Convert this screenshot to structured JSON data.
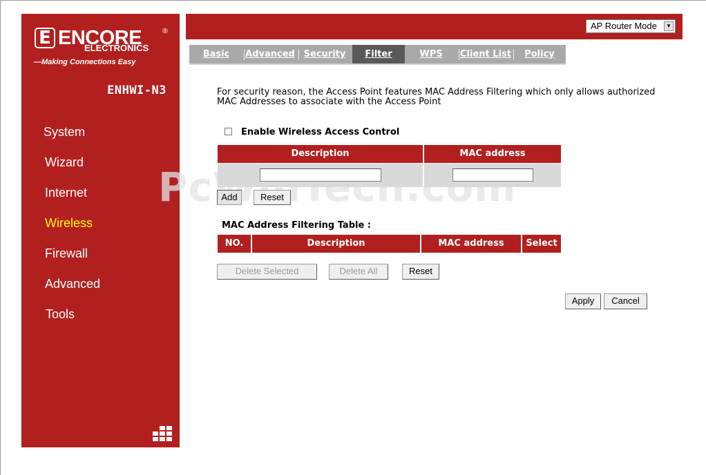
{
  "brand": {
    "name": "ENCORE",
    "registered": "®",
    "sub": "ELECTRONICS",
    "tagline": "—Making Connections Easy",
    "model": "ENHWI-N3"
  },
  "nav": [
    {
      "label": "System",
      "active": false
    },
    {
      "label": "Wizard",
      "active": false
    },
    {
      "label": "Internet",
      "active": false
    },
    {
      "label": "Wireless",
      "active": true
    },
    {
      "label": "Firewall",
      "active": false
    },
    {
      "label": "Advanced",
      "active": false
    },
    {
      "label": "Tools",
      "active": false
    }
  ],
  "mode_select": {
    "value": "AP Router Mode"
  },
  "tabs": [
    {
      "label": "Basic",
      "active": false
    },
    {
      "label": "Advanced",
      "active": false
    },
    {
      "label": "Security",
      "active": false
    },
    {
      "label": "Filter",
      "active": true
    },
    {
      "label": "WPS",
      "active": false
    },
    {
      "label": "Client List",
      "active": false
    },
    {
      "label": "Policy",
      "active": false
    }
  ],
  "intro_line1": "For security reason, the Access Point features MAC Address Filtering which only allows authorized",
  "intro_line2": "MAC Addresses to associate with the Access Point",
  "enable_label": "Enable Wireless Access Control",
  "enable_checked": false,
  "entry_table": {
    "headers": [
      "Description",
      "MAC address"
    ],
    "description_value": "",
    "mac_value": ""
  },
  "entry_buttons": {
    "add": "Add",
    "reset": "Reset"
  },
  "filter_table": {
    "title": "MAC Address Filtering Table :",
    "headers": [
      "NO.",
      "Description",
      "MAC address",
      "Select"
    ]
  },
  "table_buttons": {
    "delete_selected": "Delete Selected",
    "delete_all": "Delete All",
    "reset": "Reset"
  },
  "form_buttons": {
    "apply": "Apply",
    "cancel": "Cancel"
  },
  "watermark": "PcWinTech.com",
  "colors": {
    "brand_red": "#b1201f",
    "active_nav": "#ffff00",
    "tab_active": "#595959",
    "tab_bar": "#a9a9a9"
  }
}
